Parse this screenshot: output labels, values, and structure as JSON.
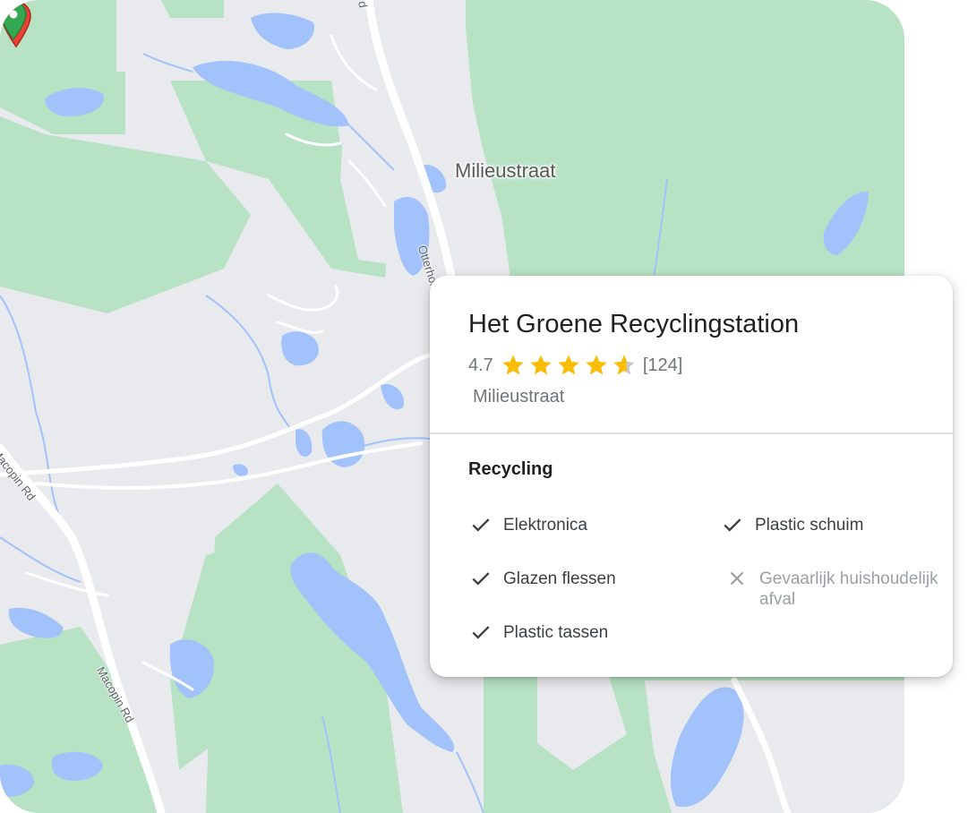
{
  "map": {
    "road_labels": {
      "otterhole": "Otterhol",
      "macopin_a": "Macopin Rd",
      "macopin_b": "Macopin Rd",
      "top_road": "d"
    },
    "selected_pin": {
      "label": "Milieustraat",
      "color": "#ea4335",
      "icon": "location-pin-icon"
    },
    "other_pin": {
      "color": "#34a853",
      "icon": "location-pin-icon"
    },
    "colors": {
      "land": "#e9eaed",
      "park": "#b7e2c4",
      "water": "#a1c2fa",
      "road": "#ffffff"
    }
  },
  "place_card": {
    "title": "Het Groene Recyclingstation",
    "rating": "4.7",
    "rating_value": 4.7,
    "rating_max": 5,
    "review_count": "[124]",
    "address": "Milieustraat",
    "star_color": "#fbbc04",
    "section_title": "Recycling",
    "amenities": [
      {
        "label": "Elektronica",
        "available": true
      },
      {
        "label": "Glazen flessen",
        "available": true
      },
      {
        "label": "Plastic tassen",
        "available": true
      },
      {
        "label": "Plastic schuim",
        "available": true
      },
      {
        "label": "Gevaarlijk huishoudelijk afval",
        "available": false
      }
    ]
  }
}
